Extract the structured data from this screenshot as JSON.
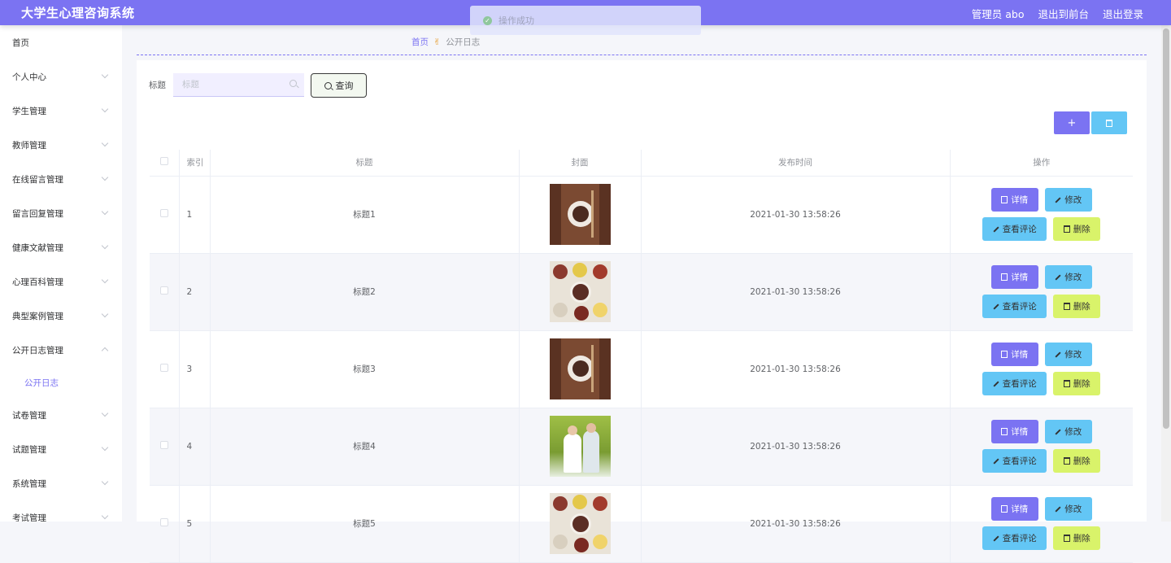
{
  "header": {
    "title": "大学生心理咨询系统",
    "user_label": "管理员 abo",
    "front_label": "退出到前台",
    "logout_label": "退出登录"
  },
  "toast": {
    "message": "操作成功"
  },
  "sidebar": {
    "items": [
      {
        "label": "首页",
        "expandable": false
      },
      {
        "label": "个人中心",
        "expandable": true
      },
      {
        "label": "学生管理",
        "expandable": true
      },
      {
        "label": "教师管理",
        "expandable": true
      },
      {
        "label": "在线留言管理",
        "expandable": true
      },
      {
        "label": "留言回复管理",
        "expandable": true
      },
      {
        "label": "健康文献管理",
        "expandable": true
      },
      {
        "label": "心理百科管理",
        "expandable": true
      },
      {
        "label": "典型案例管理",
        "expandable": true
      },
      {
        "label": "公开日志管理",
        "expandable": true,
        "open": true,
        "sub": [
          "公开日志"
        ]
      },
      {
        "label": "试卷管理",
        "expandable": true
      },
      {
        "label": "试题管理",
        "expandable": true
      },
      {
        "label": "系统管理",
        "expandable": true
      },
      {
        "label": "考试管理",
        "expandable": true
      }
    ]
  },
  "breadcrumb": {
    "home": "首页",
    "separator": "✌",
    "current": "公开日志"
  },
  "search": {
    "label": "标题",
    "placeholder": "标题",
    "value": "",
    "button": "查询"
  },
  "actions": {
    "add_symbol": "+"
  },
  "table": {
    "columns": [
      "",
      "索引",
      "标题",
      "封面",
      "发布时间",
      "操作"
    ],
    "buttons": {
      "detail": "详情",
      "edit": "修改",
      "comment": "查看评论",
      "delete": "删除"
    },
    "rows": [
      {
        "index": "1",
        "title": "标题1",
        "cover": "pot",
        "time": "2021-01-30 13:58:26"
      },
      {
        "index": "2",
        "title": "标题2",
        "cover": "seeds",
        "time": "2021-01-30 13:58:26"
      },
      {
        "index": "3",
        "title": "标题3",
        "cover": "pot",
        "time": "2021-01-30 13:58:26"
      },
      {
        "index": "4",
        "title": "标题4",
        "cover": "elder",
        "time": "2021-01-30 13:58:26"
      },
      {
        "index": "5",
        "title": "标题5",
        "cover": "seeds",
        "time": "2021-01-30 13:58:26"
      }
    ]
  },
  "colors": {
    "primary": "#7b73f2",
    "info": "#63c6f5",
    "lime": "#d9f36a"
  }
}
